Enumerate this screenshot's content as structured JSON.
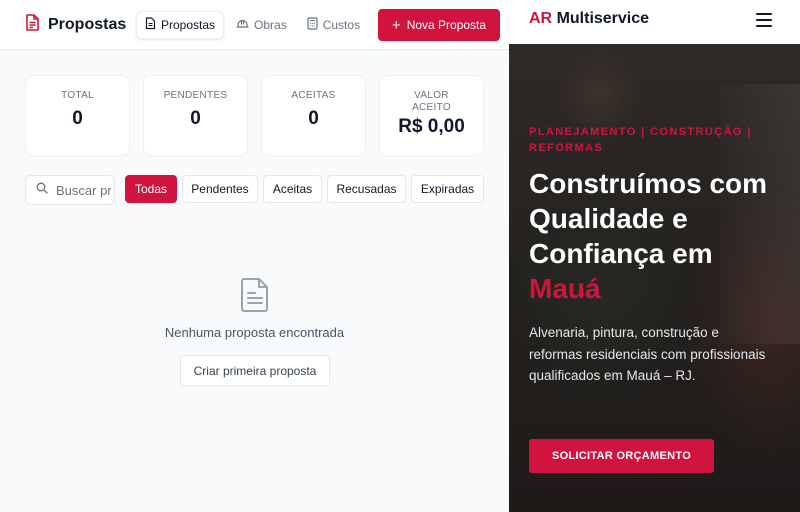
{
  "app": {
    "title": "Propostas",
    "nav_tabs": [
      {
        "label": "Propostas",
        "icon": "document-icon",
        "active": true
      },
      {
        "label": "Obras",
        "icon": "helmet-icon",
        "active": false
      },
      {
        "label": "Custos",
        "icon": "calculator-icon",
        "active": false
      }
    ],
    "new_button_label": "Nova Proposta",
    "stats": [
      {
        "label": "TOTAL",
        "value": "0"
      },
      {
        "label": "PENDENTES",
        "value": "0"
      },
      {
        "label": "ACEITAS",
        "value": "0"
      },
      {
        "label": "VALOR ACEITO",
        "value": "R$ 0,00"
      }
    ],
    "search": {
      "placeholder": "Buscar propostas..."
    },
    "filters": [
      {
        "label": "Todas",
        "active": true
      },
      {
        "label": "Pendentes",
        "active": false
      },
      {
        "label": "Aceitas",
        "active": false
      },
      {
        "label": "Recusadas",
        "active": false
      },
      {
        "label": "Expiradas",
        "active": false
      }
    ],
    "empty_state": {
      "message": "Nenhuma proposta encontrada",
      "button_label": "Criar primeira proposta"
    },
    "accent_color": "#d0143f"
  },
  "site": {
    "logo_accent": "AR",
    "logo_rest": "Multiservice",
    "tagline": "PLANEJAMENTO | CONSTRUÇÃO | REFORMAS",
    "hero_title": "Construímos com Qualidade e Confiança em",
    "hero_city": "Mauá",
    "hero_description": "Alvenaria, pintura, construção e reformas residenciais com profissionais qualificados em Mauá – RJ.",
    "cta_label": "SOLICITAR ORÇAMENTO",
    "accent_color": "#d0143f"
  }
}
